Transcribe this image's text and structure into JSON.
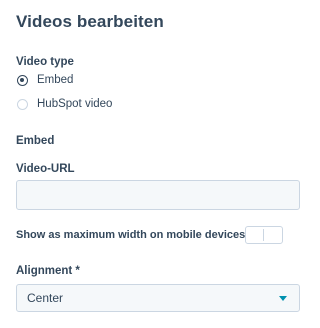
{
  "title": "Videos bearbeiten",
  "video_type": {
    "label": "Video type",
    "options": [
      {
        "label": "Embed",
        "checked": true
      },
      {
        "label": "HubSpot video",
        "checked": false
      }
    ]
  },
  "embed": {
    "heading": "Embed",
    "url_label": "Video-URL",
    "url_value": ""
  },
  "mobile_toggle": {
    "label": "Show as maximum width on mobile devices",
    "info_icon": "info-icon",
    "on": false
  },
  "alignment": {
    "label": "Alignment *",
    "selected": "Center",
    "caret_icon": "caret-down-icon"
  },
  "colors": {
    "text": "#33475b",
    "field_bg": "#f5f8fa",
    "border": "#cbd6e2",
    "accent": "#0091ae"
  }
}
